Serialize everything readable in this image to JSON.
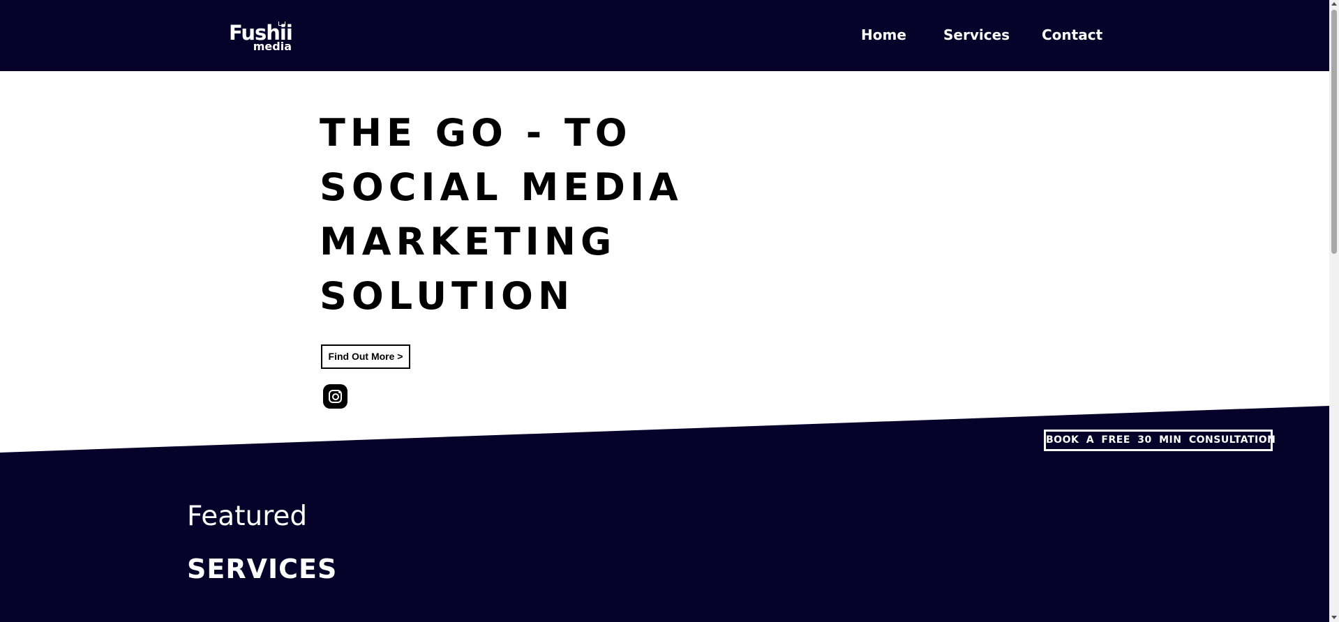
{
  "colors": {
    "navy": "#07022a",
    "white": "#ffffff",
    "black": "#000000"
  },
  "header": {
    "logo_main": "Fushii",
    "logo_sub": "media",
    "nav": {
      "home": "Home",
      "services": "Services",
      "contact": "Contact"
    }
  },
  "hero": {
    "title_lines": [
      "THE GO - TO",
      "SOCIAL MEDIA",
      "MARKETING",
      "SOLUTION"
    ],
    "cta_label": "Find Out More >",
    "social_icon": "instagram-icon"
  },
  "consultation": {
    "label": "BOOK A FREE 30 MIN CONSULTATION"
  },
  "featured": {
    "kicker": "Featured",
    "heading": "SERVICES"
  }
}
